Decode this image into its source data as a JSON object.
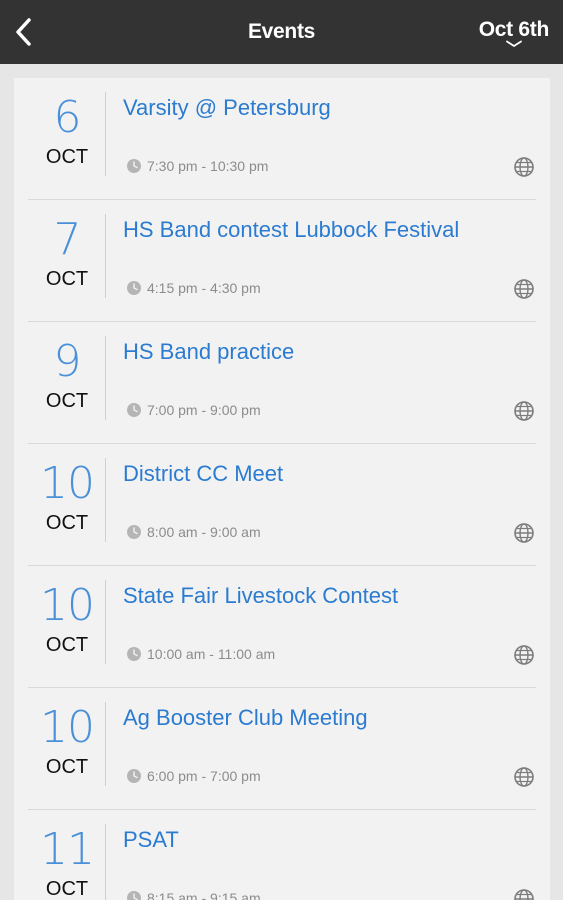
{
  "header": {
    "title": "Events",
    "date_label": "Oct 6th"
  },
  "events": [
    {
      "day": "6",
      "month": "OCT",
      "title": "Varsity @ Petersburg",
      "time": "7:30 pm - 10:30 pm"
    },
    {
      "day": "7",
      "month": "OCT",
      "title": "HS Band contest Lubbock Festival",
      "time": "4:15 pm - 4:30 pm"
    },
    {
      "day": "9",
      "month": "OCT",
      "title": "HS Band practice",
      "time": "7:00 pm - 9:00 pm"
    },
    {
      "day": "10",
      "month": "OCT",
      "title": "District CC Meet",
      "time": "8:00 am - 9:00 am"
    },
    {
      "day": "10",
      "month": "OCT",
      "title": "State Fair Livestock Contest",
      "time": "10:00 am - 11:00 am"
    },
    {
      "day": "10",
      "month": "OCT",
      "title": "Ag Booster Club Meeting",
      "time": "6:00 pm - 7:00 pm"
    },
    {
      "day": "11",
      "month": "OCT",
      "title": "PSAT",
      "time": "8:15 am - 9:15 am"
    }
  ],
  "colors": {
    "header_bg": "#333333",
    "accent": "#2b7bd0",
    "day_number": "#4a90d9",
    "card_bg": "#f2f2f2"
  },
  "icons": {
    "back": "chevron-left-icon",
    "date_dropdown": "chevron-down-icon",
    "time": "clock-icon",
    "web": "globe-icon"
  }
}
